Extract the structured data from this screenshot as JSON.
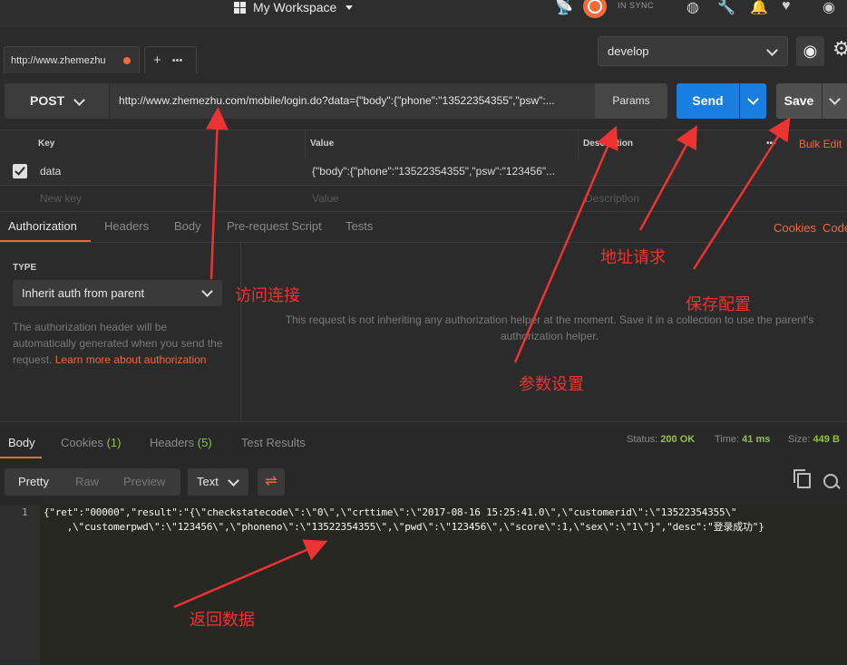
{
  "topbar": {
    "workspace": "My Workspace",
    "sync": "IN SYNC"
  },
  "tabs": {
    "active": "http://www.zhemezhu",
    "plus": "+",
    "more": "•••"
  },
  "environment": {
    "selected": "develop"
  },
  "request": {
    "method": "POST",
    "url": "http://www.zhemezhu.com/mobile/login.do?data={\"body\":{\"phone\":\"13522354355\",\"psw\":...",
    "params": "Params",
    "send": "Send",
    "save": "Save"
  },
  "params_table": {
    "headers": {
      "key": "Key",
      "value": "Value",
      "description": "Description",
      "more": "•••",
      "bulk": "Bulk Edit"
    },
    "rows": [
      {
        "key": "data",
        "value": "{\"body\":{\"phone\":\"13522354355\",\"psw\":\"123456\"..."
      }
    ],
    "placeholder": {
      "key": "New key",
      "value": "Value",
      "description": "Description"
    }
  },
  "request_tabs": [
    "Authorization",
    "Headers",
    "Body",
    "Pre-request Script",
    "Tests"
  ],
  "request_links": {
    "cookies": "Cookies",
    "code": "Code"
  },
  "auth": {
    "type_label": "TYPE",
    "type_value": "Inherit auth from parent",
    "help": "The authorization header will be automatically generated when you send the request.",
    "help_link": "Learn more about authorization",
    "message": "This request is not inheriting any authorization helper at the moment. Save it in a collection to use the parent's authorization helper."
  },
  "response_tabs": {
    "body": "Body",
    "cookies": "Cookies",
    "cookies_count": "(1)",
    "headers": "Headers",
    "headers_count": "(5)",
    "tests": "Test Results"
  },
  "response_status": {
    "status_label": "Status:",
    "status": "200 OK",
    "time_label": "Time:",
    "time": "41 ms",
    "size_label": "Size:",
    "size": "449 B"
  },
  "view": {
    "pretty": "Pretty",
    "raw": "Raw",
    "preview": "Preview",
    "format": "Text"
  },
  "body": {
    "line_number": "1",
    "line1": "{\"ret\":\"00000\",\"result\":\"{\\\"checkstatecode\\\":\\\"0\\\",\\\"crttime\\\":\\\"2017-08-16 15:25:41.0\\\",\\\"customerid\\\":\\\"13522354355\\\"",
    "line2": "    ,\\\"customerpwd\\\":\\\"123456\\\",\\\"phoneno\\\":\\\"13522354355\\\",\\\"pwd\\\":\\\"123456\\\",\\\"score\\\":1,\\\"sex\\\":\\\"1\\\"}\",\"desc\":\"登录成功\"}"
  },
  "annotations": {
    "visit": "访问连接",
    "address": "地址请求",
    "save_config": "保存配置",
    "params": "参数设置",
    "response": "返回数据"
  },
  "colors": {
    "accent": "#f26b3a",
    "send": "#1a7ee0",
    "ok": "#8ec63f",
    "annotation": "#e33333"
  }
}
